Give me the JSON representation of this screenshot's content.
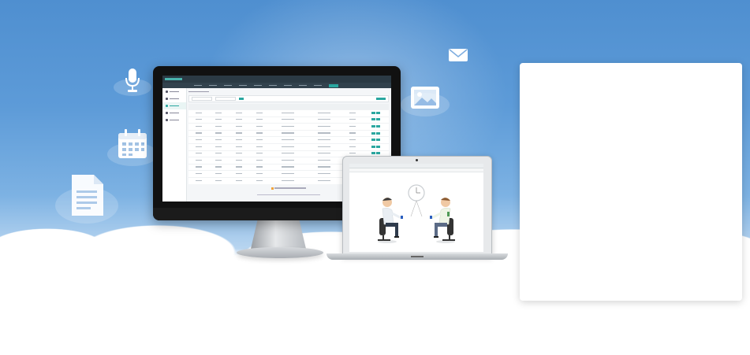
{
  "colors": {
    "sky_top": "#4f8fd0",
    "accent": "#2aa7a0",
    "monitor_bezel": "#111111",
    "pager_highlight": "#f0a43c"
  },
  "floating_icons": [
    {
      "name": "microphone-icon"
    },
    {
      "name": "calendar-icon"
    },
    {
      "name": "document-icon"
    },
    {
      "name": "envelope-icon"
    },
    {
      "name": "image-icon"
    }
  ],
  "monitor_app": {
    "sidebar_item_count": 5,
    "table_row_count": 11,
    "table_column_count": 8,
    "selected_page": 1
  },
  "laptop": {
    "scene": "two-people-meeting",
    "scene_elements": [
      "person-left",
      "person-right",
      "wall-clock",
      "chair",
      "chair"
    ]
  },
  "panel": {
    "content": ""
  }
}
